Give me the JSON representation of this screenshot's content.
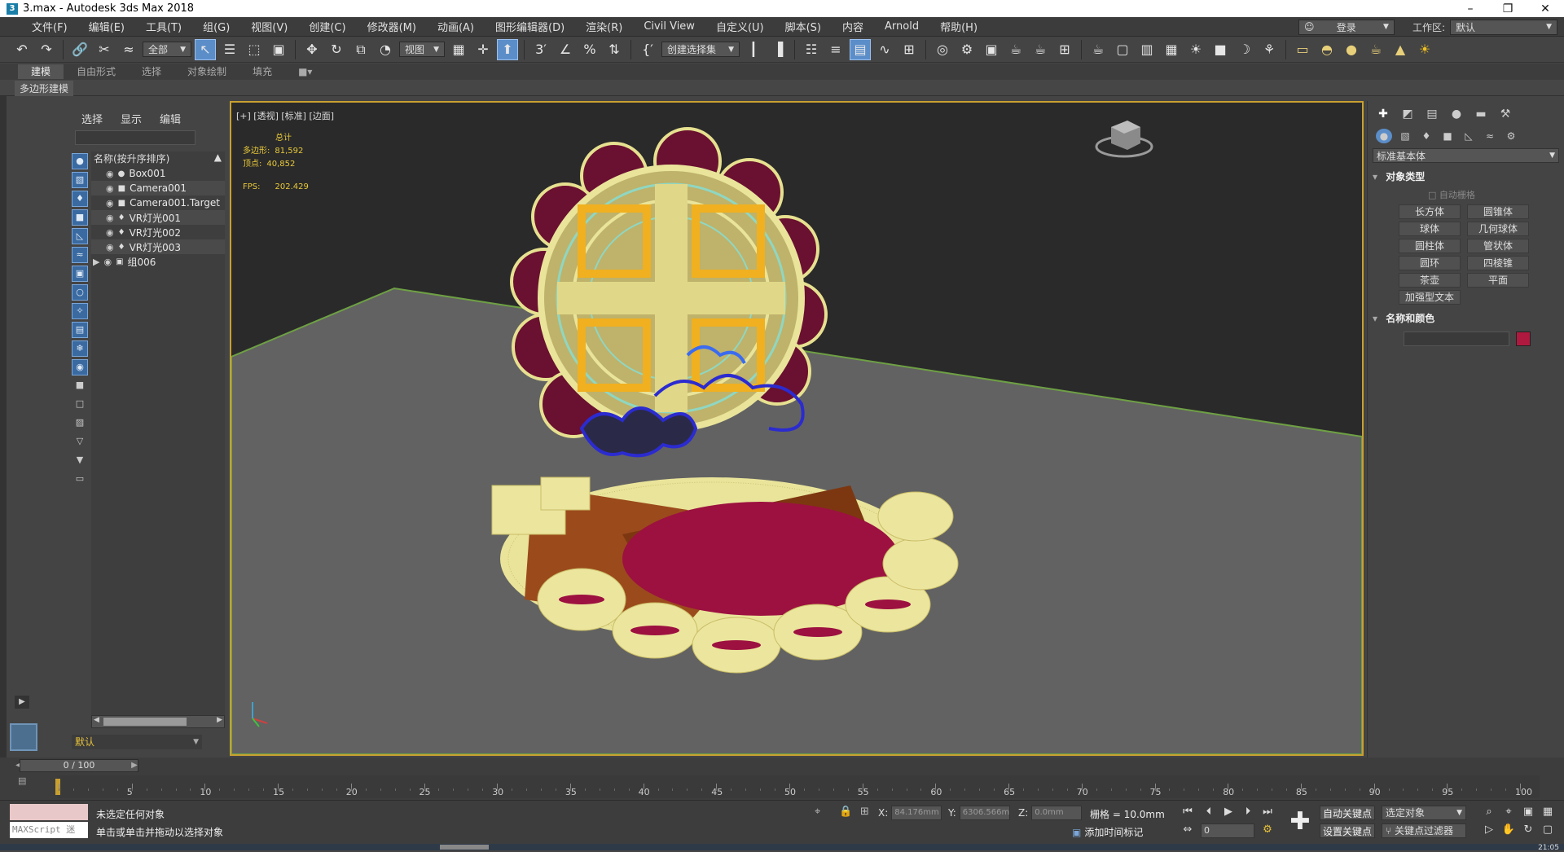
{
  "window": {
    "title": "3.max - Autodesk 3ds Max 2018",
    "icon_label": "3"
  },
  "menu": [
    "文件(F)",
    "编辑(E)",
    "工具(T)",
    "组(G)",
    "视图(V)",
    "创建(C)",
    "修改器(M)",
    "动画(A)",
    "图形编辑器(D)",
    "渲染(R)",
    "Civil View",
    "自定义(U)",
    "脚本(S)",
    "内容",
    "Arnold",
    "帮助(H)"
  ],
  "menu_right": {
    "login": "登录",
    "workspace_label": "工作区:",
    "workspace_value": "默认"
  },
  "toolbar": {
    "filter": "全部",
    "ref_coord": "视图",
    "selection_set": "创建选择集"
  },
  "ribbon": {
    "tabs": [
      "建模",
      "自由形式",
      "选择",
      "对象绘制",
      "填充"
    ],
    "active": 0,
    "subtab": "多边形建模"
  },
  "scene_explorer": {
    "tabs": [
      "选择",
      "显示",
      "编辑"
    ],
    "header": "名称(按升序排序)",
    "items": [
      {
        "name": "Box001",
        "type": "box"
      },
      {
        "name": "Camera001",
        "type": "camera"
      },
      {
        "name": "Camera001.Target",
        "type": "camera"
      },
      {
        "name": "VR灯光001",
        "type": "light"
      },
      {
        "name": "VR灯光002",
        "type": "light"
      },
      {
        "name": "VR灯光003",
        "type": "light"
      },
      {
        "name": "组006",
        "type": "group"
      }
    ],
    "layer": "默认"
  },
  "viewport": {
    "label": "[+] [透视] [标准] [边面]",
    "stats": {
      "total_label": "总计",
      "poly_label": "多边形:",
      "poly_value": "81,592",
      "vert_label": "顶点:",
      "vert_value": "40,852",
      "fps_label": "FPS:",
      "fps_value": "202.429"
    },
    "axis_x": "x",
    "axis_y": "y",
    "axis_z": "z"
  },
  "command_panel": {
    "dropdown": "标准基本体",
    "section_object_type": "对象类型",
    "autogrid": "自动栅格",
    "buttons": [
      "长方体",
      "圆锥体",
      "球体",
      "几何球体",
      "圆柱体",
      "管状体",
      "圆环",
      "四棱锥",
      "茶壶",
      "平面",
      "加强型文本"
    ],
    "section_name_color": "名称和颜色",
    "object_color": "#b0193f"
  },
  "timeline": {
    "frame_display": "0 / 100",
    "ticks": [
      0,
      5,
      10,
      15,
      20,
      25,
      30,
      35,
      40,
      45,
      50,
      55,
      60,
      65,
      70,
      75,
      80,
      85,
      90,
      95,
      100
    ]
  },
  "status": {
    "line1": "未选定任何对象",
    "line2": "单击或单击并拖动以选择对象",
    "maxscript": "MAXScript 迷",
    "x_label": "X:",
    "x_value": "84.176mm",
    "y_label": "Y:",
    "y_value": "6306.566m",
    "z_label": "Z:",
    "z_value": "0.0mm",
    "grid": "栅格 = 10.0mm",
    "add_time_tag": "添加时间标记",
    "frame": "0",
    "auto_key": "自动关键点",
    "set_key": "设置关键点",
    "selected_object": "选定对象",
    "key_filter": "关键点过滤器",
    "clock": "21:05"
  }
}
